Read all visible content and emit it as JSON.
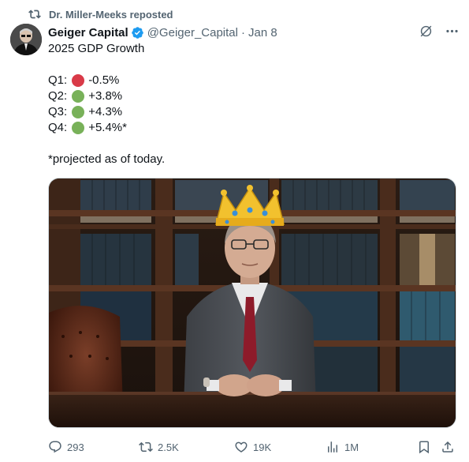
{
  "repost": {
    "label": "Dr. Miller-Meeks reposted",
    "icon": "repost-icon"
  },
  "author": {
    "display_name": "Geiger Capital",
    "verified": true,
    "handle": "@Geiger_Capital",
    "separator": "·",
    "time": "Jan 8"
  },
  "tweet": {
    "title": "2025 GDP Growth",
    "quarters": [
      {
        "label": "Q1:",
        "value": "-0.5%",
        "status_color": "#d93a48"
      },
      {
        "label": "Q2:",
        "value": "+3.8%",
        "status_color": "#78b159"
      },
      {
        "label": "Q3:",
        "value": "+4.3%",
        "status_color": "#78b159"
      },
      {
        "label": "Q4:",
        "value": "+5.4%*",
        "status_color": "#78b159"
      }
    ],
    "footnote": "*projected as of today."
  },
  "media": {
    "description_icon": "photo-man-at-desk-with-crown"
  },
  "actions": {
    "replies": "293",
    "reposts": "2.5K",
    "likes": "19K",
    "views": "1M"
  },
  "colors": {
    "text_primary": "#0f1419",
    "text_secondary": "#536471",
    "verified_blue": "#1d9bf0",
    "red_circle": "#d93a48",
    "green_circle": "#78b159"
  }
}
